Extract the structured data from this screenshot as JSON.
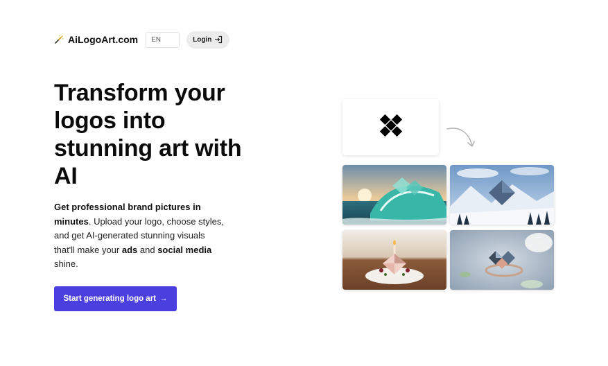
{
  "header": {
    "brand_name": "AiLogoArt.com",
    "brand_icon": "magic-wand-icon",
    "language": "EN",
    "login_label": "Login",
    "login_icon": "login-arrow-icon"
  },
  "hero": {
    "title": "Transform your logos into stunning art with AI",
    "description": {
      "bold_1": "Get professional brand pictures in minutes",
      "text_1": ". Upload your logo, choose styles, and get AI-generated stunning visuals that'll make your ",
      "bold_2": "ads",
      "text_2": " and ",
      "bold_3": "social media",
      "text_3": " shine."
    },
    "cta_label": "Start generating logo art",
    "cta_arrow": "→"
  },
  "showcase": {
    "logo_icon": "diamond-logo-icon",
    "arrow_icon": "curved-arrow-icon",
    "images": [
      "ocean-wave-logo-art",
      "snowy-mountain-logo-art",
      "cake-logo-art",
      "jewel-ring-logo-art"
    ]
  },
  "colors": {
    "accent": "#4b3fe0",
    "login_bg": "#ececec",
    "text": "#111111"
  }
}
